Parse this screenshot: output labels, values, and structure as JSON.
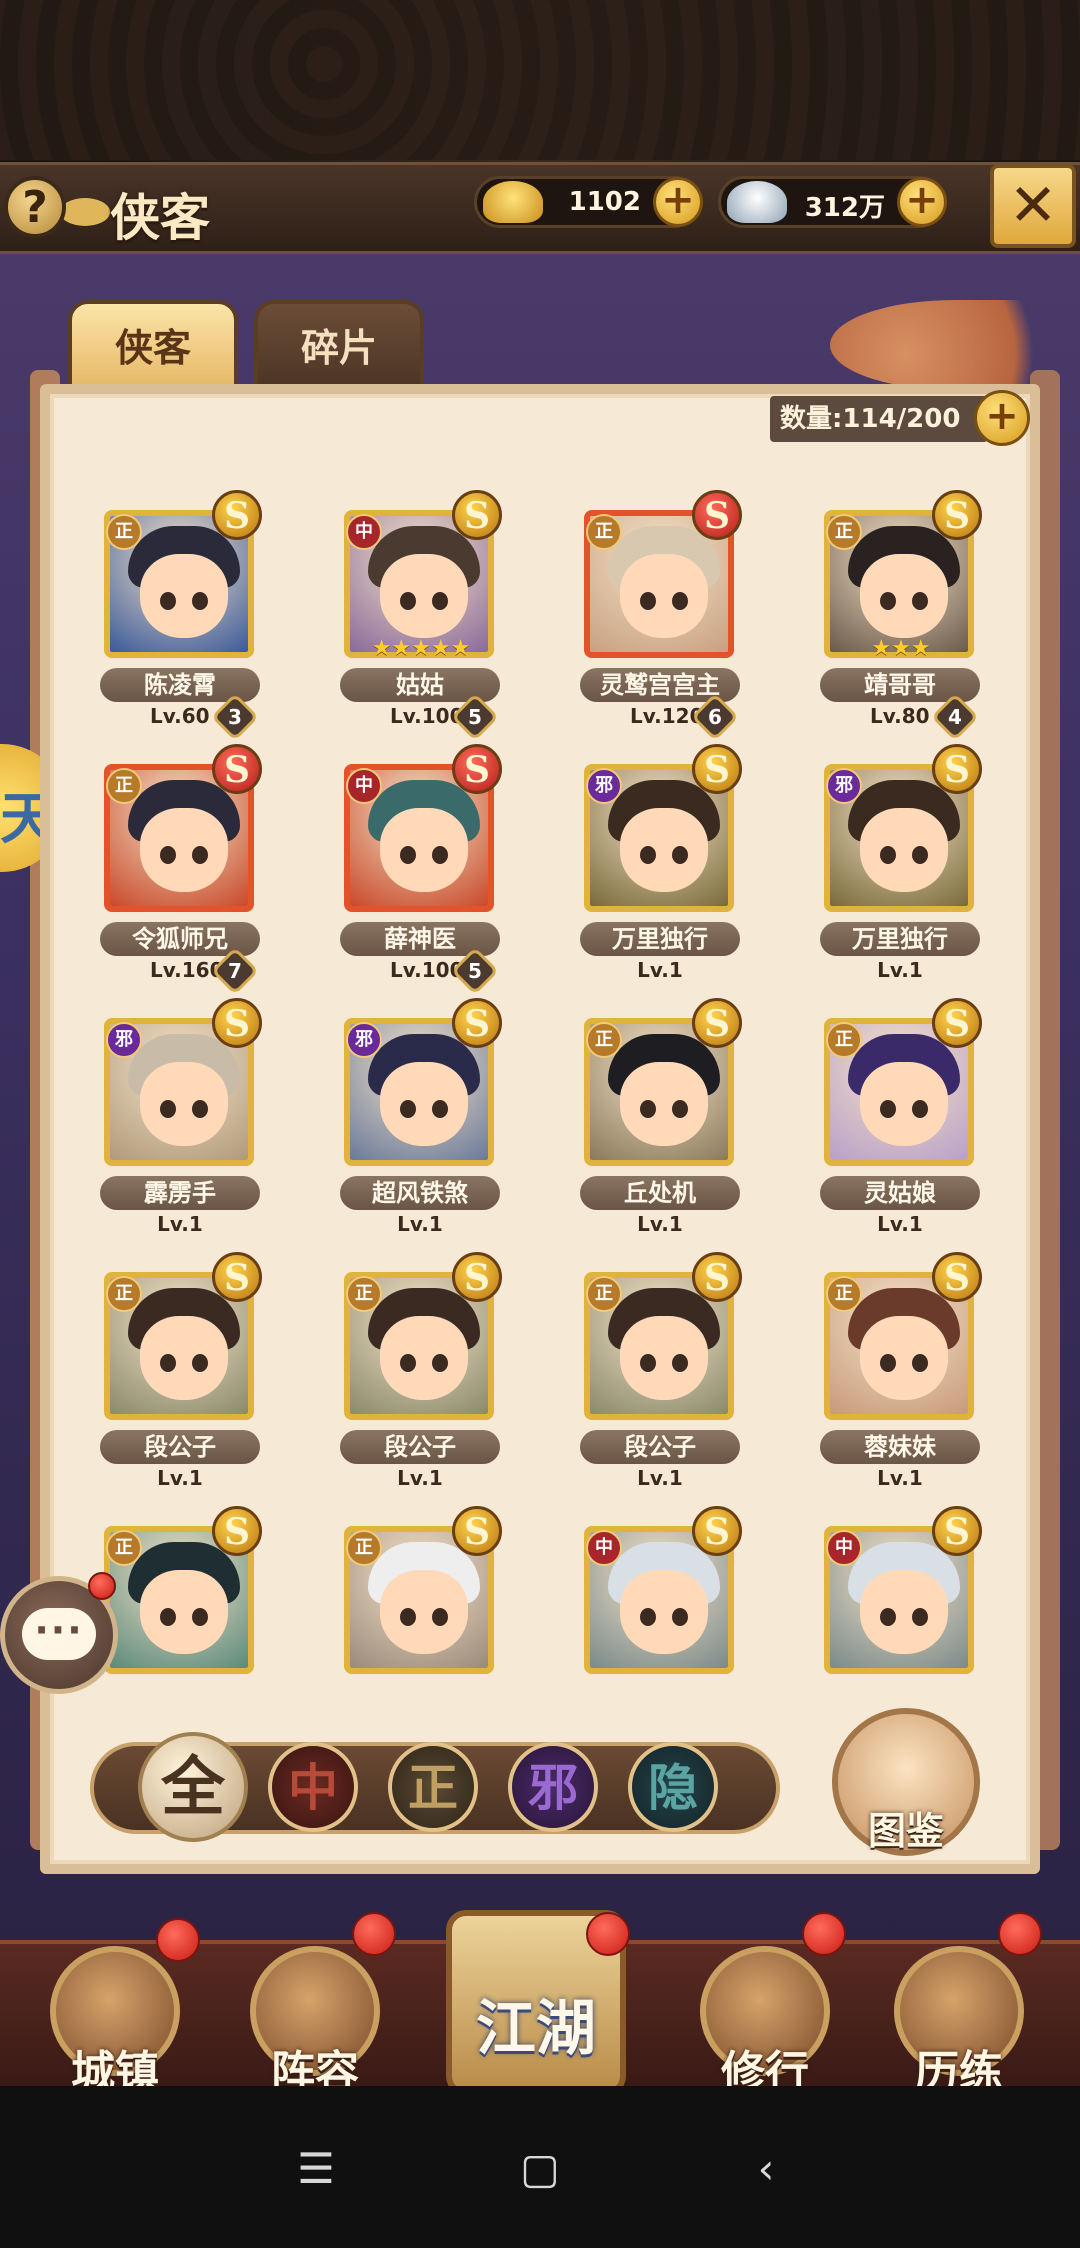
{
  "header": {
    "help_label": "?",
    "title": "侠客",
    "gold_amount": "1102",
    "silver_amount": "312万",
    "close_icon_glyph": "✕"
  },
  "tabs": [
    {
      "label": "侠客",
      "active": true
    },
    {
      "label": "碎片",
      "active": false
    }
  ],
  "roster": {
    "count_label": "数量:114/200"
  },
  "side_tab_glyph": "天",
  "heroes": [
    {
      "name": "陈凌霄",
      "level": "Lv.60",
      "badge": "3",
      "align": "正",
      "rank": "S",
      "stars": "",
      "frame": "gold",
      "hair": "#2a2a3a",
      "bg": "#3a5a9a"
    },
    {
      "name": "姑姑",
      "level": "Lv.100",
      "badge": "5",
      "align": "中",
      "rank": "S",
      "stars": "★★★★★",
      "frame": "gold",
      "hair": "#4a3a30",
      "bg": "#8a6a9a"
    },
    {
      "name": "灵鹫宫宫主",
      "level": "Lv.120",
      "badge": "6",
      "align": "正",
      "rank": "SS",
      "stars": "",
      "frame": "red",
      "hair": "#d9c8b0",
      "bg": "#c8a080"
    },
    {
      "name": "靖哥哥",
      "level": "Lv.80",
      "badge": "4",
      "align": "正",
      "rank": "S",
      "stars": "★★★",
      "frame": "gold",
      "hair": "#2a2220",
      "bg": "#6a5a4a"
    },
    {
      "name": "令狐师兄",
      "level": "Lv.160",
      "badge": "7",
      "align": "正",
      "rank": "SS",
      "stars": "",
      "frame": "red",
      "hair": "#2a2a3a",
      "bg": "#c84a2a"
    },
    {
      "name": "薛神医",
      "level": "Lv.100",
      "badge": "5",
      "align": "中",
      "rank": "SS",
      "stars": "",
      "frame": "red",
      "hair": "#3a6a6a",
      "bg": "#c84a2a"
    },
    {
      "name": "万里独行",
      "level": "Lv.1",
      "badge": "",
      "align": "邪",
      "rank": "S",
      "stars": "",
      "frame": "gold",
      "hair": "#3a2a20",
      "bg": "#7a6a3a"
    },
    {
      "name": "万里独行",
      "level": "Lv.1",
      "badge": "",
      "align": "邪",
      "rank": "S",
      "stars": "",
      "frame": "gold",
      "hair": "#3a2a20",
      "bg": "#7a6a3a"
    },
    {
      "name": "霹雳手",
      "level": "Lv.1",
      "badge": "",
      "align": "邪",
      "rank": "S",
      "stars": "",
      "frame": "gold",
      "hair": "#c8bca8",
      "bg": "#b09a7a"
    },
    {
      "name": "超风铁煞",
      "level": "Lv.1",
      "badge": "",
      "align": "邪",
      "rank": "S",
      "stars": "",
      "frame": "gold",
      "hair": "#2a2a4a",
      "bg": "#6a7a9a"
    },
    {
      "name": "丘处机",
      "level": "Lv.1",
      "badge": "",
      "align": "正",
      "rank": "S",
      "stars": "",
      "frame": "gold",
      "hair": "#1e1e22",
      "bg": "#8a7a5a"
    },
    {
      "name": "灵姑娘",
      "level": "Lv.1",
      "badge": "",
      "align": "正",
      "rank": "S",
      "stars": "",
      "frame": "gold",
      "hair": "#3a2a6a",
      "bg": "#b8a0c8"
    },
    {
      "name": "段公子",
      "level": "Lv.1",
      "badge": "",
      "align": "正",
      "rank": "S",
      "stars": "",
      "frame": "gold",
      "hair": "#3a2a22",
      "bg": "#8a8a6a"
    },
    {
      "name": "段公子",
      "level": "Lv.1",
      "badge": "",
      "align": "正",
      "rank": "S",
      "stars": "",
      "frame": "gold",
      "hair": "#3a2a22",
      "bg": "#8a8a6a"
    },
    {
      "name": "段公子",
      "level": "Lv.1",
      "badge": "",
      "align": "正",
      "rank": "S",
      "stars": "",
      "frame": "gold",
      "hair": "#3a2a22",
      "bg": "#8a8a6a"
    },
    {
      "name": "蓉妹妹",
      "level": "Lv.1",
      "badge": "",
      "align": "正",
      "rank": "S",
      "stars": "",
      "frame": "gold",
      "hair": "#6a3a2a",
      "bg": "#c89a7a"
    },
    {
      "name": "",
      "level": "",
      "badge": "",
      "align": "正",
      "rank": "S",
      "stars": "",
      "frame": "gold",
      "hair": "#1e2e32",
      "bg": "#5a8a7a"
    },
    {
      "name": "",
      "level": "",
      "badge": "",
      "align": "正",
      "rank": "S",
      "stars": "",
      "frame": "gold",
      "hair": "#eeeeee",
      "bg": "#9a8a7a"
    },
    {
      "name": "",
      "level": "",
      "badge": "",
      "align": "中",
      "rank": "S",
      "stars": "",
      "frame": "gold",
      "hair": "#d8e0e6",
      "bg": "#7a8a8a"
    },
    {
      "name": "",
      "level": "",
      "badge": "",
      "align": "中",
      "rank": "S",
      "stars": "",
      "frame": "gold",
      "hair": "#d8e0e6",
      "bg": "#7a8a8a"
    }
  ],
  "align_colors": {
    "正": "#b57a2a",
    "中": "#a8262a",
    "邪": "#6a2a9a"
  },
  "filters": [
    {
      "label": "全",
      "active": true
    },
    {
      "label": "中",
      "active": false
    },
    {
      "label": "正",
      "active": false
    },
    {
      "label": "邪",
      "active": false
    },
    {
      "label": "隐",
      "active": false
    }
  ],
  "codex_label": "图鉴",
  "chat_glyph": "···",
  "bottom_nav": [
    {
      "label": "城镇"
    },
    {
      "label": "阵容"
    },
    {
      "label": "江湖"
    },
    {
      "label": "修行"
    },
    {
      "label": "历练"
    }
  ],
  "system_nav": {
    "menu": "☰",
    "home": "▢",
    "back": "‹"
  }
}
